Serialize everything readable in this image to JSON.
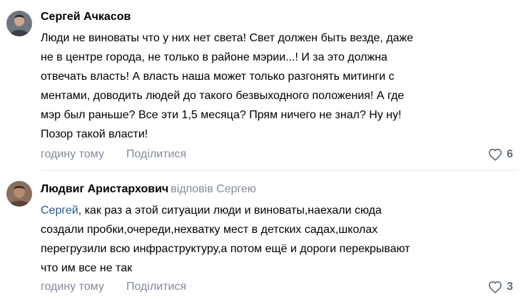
{
  "comments": [
    {
      "author": "Сергей Ачкасов",
      "text_lines": [
        "Люди не виноваты что у них нет света! Свет должен быть везде, даже",
        "не в центре города, не только в районе мэрии...! И за это должна",
        "отвечать власть! А власть наша может только разгонять митинги с",
        "ментами, доводить людей до такого безвыходного положения! А где",
        "мэр был раньше? Все эти 1,5 месяца? Прям ничего не знал? Ну ну!",
        "Позор такой власти!"
      ],
      "time": "годину тому",
      "share_label": "Поділитися",
      "likes": "6"
    },
    {
      "author": "Людвиг Аристархович",
      "reply_meta": "відповів Сергею",
      "mention": "Сергей",
      "text_line1_rest": ", как раз а этой ситуации люди и виноваты,наехали сюда",
      "text_lines_rest": [
        "создали пробки,очереди,нехватку мест в детских садах,школах",
        "перегрузили всю инфраструктуру,а потом ещё и дороги перекрывают",
        "что им все не так"
      ],
      "time": "годину тому",
      "share_label": "Поділитися",
      "likes": "3"
    }
  ],
  "icons": {
    "like": "heart-outline-icon"
  },
  "colors": {
    "link": "#2a5885",
    "meta": "#828a99",
    "divider": "#e7e8ec"
  }
}
